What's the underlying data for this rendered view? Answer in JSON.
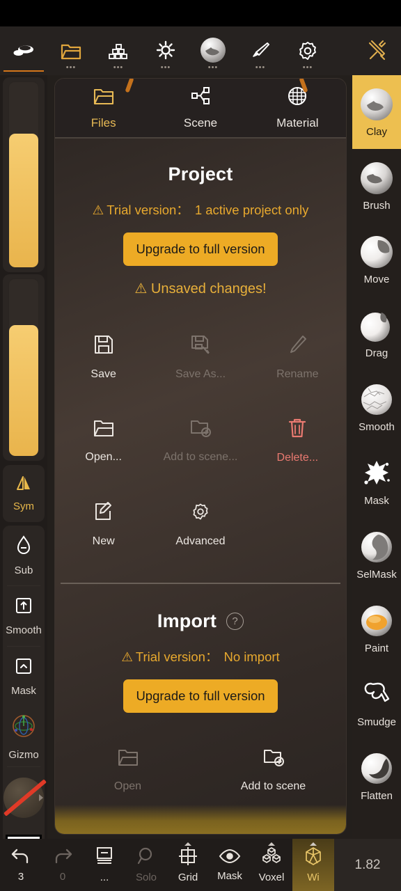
{
  "app": {
    "version_label": "1.82"
  },
  "topbar": {
    "items": [
      {
        "name": "sculpt-tool",
        "icon": "clay-stroke-icon",
        "active": true,
        "has_dots": false
      },
      {
        "name": "files",
        "icon": "folder-icon",
        "active": false,
        "has_dots": true
      },
      {
        "name": "layers",
        "icon": "stack-icon",
        "active": false,
        "has_dots": true
      },
      {
        "name": "lighting",
        "icon": "sun-icon",
        "active": false,
        "has_dots": true
      },
      {
        "name": "material",
        "icon": "sphere-icon",
        "active": false,
        "has_dots": true
      },
      {
        "name": "paint",
        "icon": "brush-icon",
        "active": false,
        "has_dots": true
      },
      {
        "name": "settings",
        "icon": "gear-icon",
        "active": false,
        "has_dots": true
      },
      {
        "name": "tools",
        "icon": "tools-icon",
        "active": false,
        "has_dots": false
      }
    ]
  },
  "left_sidebar": {
    "sliders": [
      {
        "name": "radius-slider",
        "fill_percent": 72
      },
      {
        "name": "intensity-slider",
        "fill_percent": 74
      }
    ],
    "buttons": [
      {
        "label": "Sym",
        "icon": "symmetry-icon",
        "accent": "#e8b84b"
      },
      {
        "label": "Sub",
        "icon": "subtract-drop-icon",
        "accent": "#ffffff"
      },
      {
        "label": "Smooth",
        "icon": "smooth-square-icon",
        "accent": "#ffffff"
      },
      {
        "label": "Mask",
        "icon": "mask-square-icon",
        "accent": "#ffffff"
      },
      {
        "label": "Gizmo",
        "icon": "gizmo-icon",
        "accent": "#ffffff"
      }
    ],
    "material_swatch": {
      "name": "material-swatch",
      "disabled": true
    },
    "color_swatch": {
      "name": "color-swatch",
      "color": "#ffffff"
    }
  },
  "right_sidebar": {
    "tools": [
      {
        "label": "Clay",
        "icon": "clay-ball-icon",
        "active": true
      },
      {
        "label": "Brush",
        "icon": "brush-ball-icon",
        "active": false
      },
      {
        "label": "Move",
        "icon": "move-ball-icon",
        "active": false
      },
      {
        "label": "Drag",
        "icon": "drag-ball-icon",
        "active": false
      },
      {
        "label": "Smooth",
        "icon": "smooth-ball-icon",
        "active": false
      },
      {
        "label": "Mask",
        "icon": "mask-splat-icon",
        "active": false
      },
      {
        "label": "SelMask",
        "icon": "selmask-ball-icon",
        "active": false
      },
      {
        "label": "Paint",
        "icon": "paint-ball-icon",
        "active": false
      },
      {
        "label": "Smudge",
        "icon": "smudge-icon",
        "active": false
      },
      {
        "label": "Flatten",
        "icon": "flatten-ball-icon",
        "active": false
      }
    ]
  },
  "panel": {
    "tabs": [
      {
        "label": "Files",
        "icon": "folder-icon",
        "active": true
      },
      {
        "label": "Scene",
        "icon": "share-nodes-icon",
        "active": false
      },
      {
        "label": "Material",
        "icon": "material-sphere-icon",
        "active": false
      }
    ],
    "project": {
      "title": "Project",
      "trial_label": "Trial version：",
      "trial_value": "1 active project only",
      "upgrade_button": "Upgrade to full version",
      "unsaved_text": "Unsaved changes!",
      "actions": [
        {
          "label": "Save",
          "icon": "save-icon",
          "state": "enabled"
        },
        {
          "label": "Save As...",
          "icon": "save-as-icon",
          "state": "disabled"
        },
        {
          "label": "Rename",
          "icon": "pencil-icon",
          "state": "disabled"
        },
        {
          "label": "Open...",
          "icon": "folder-open-icon",
          "state": "enabled"
        },
        {
          "label": "Add to scene...",
          "icon": "folder-add-icon",
          "state": "disabled"
        },
        {
          "label": "Delete...",
          "icon": "trash-icon",
          "state": "danger"
        },
        {
          "label": "New",
          "icon": "new-document-icon",
          "state": "enabled"
        },
        {
          "label": "Advanced",
          "icon": "gear-icon",
          "state": "enabled"
        }
      ]
    },
    "import": {
      "title": "Import",
      "help_icon": "question-mark-icon",
      "trial_label": "Trial version：",
      "trial_value": "No import",
      "upgrade_button": "Upgrade to full version",
      "actions": [
        {
          "label": "Open",
          "icon": "folder-open-icon",
          "state": "disabled"
        },
        {
          "label": "Add to scene",
          "icon": "folder-add-icon",
          "state": "enabled"
        }
      ]
    }
  },
  "bottombar": {
    "items": [
      {
        "label": "3",
        "icon": "undo-icon",
        "state": "enabled",
        "caret": false
      },
      {
        "label": "0",
        "icon": "redo-icon",
        "state": "disabled",
        "caret": false
      },
      {
        "label": "...",
        "icon": "layers-list-icon",
        "state": "enabled",
        "caret": false
      },
      {
        "label": "Solo",
        "icon": "magnifier-icon",
        "state": "disabled",
        "caret": false
      },
      {
        "label": "Grid",
        "icon": "grid-frame-icon",
        "state": "enabled",
        "caret": true
      },
      {
        "label": "Mask",
        "icon": "eye-icon",
        "state": "enabled",
        "caret": false
      },
      {
        "label": "Voxel",
        "icon": "voxel-cubes-icon",
        "state": "enabled",
        "caret": true
      },
      {
        "label": "Wi",
        "icon": "wireframe-icon",
        "state": "highlight",
        "caret": true
      }
    ],
    "zoom_value": "1.82"
  },
  "colors": {
    "accent_orange": "#edab25",
    "warn_yellow": "#e8a92e",
    "danger_red": "#ea7a71",
    "panel_bg": "#3d342e",
    "toolbar_bg": "#262220"
  }
}
